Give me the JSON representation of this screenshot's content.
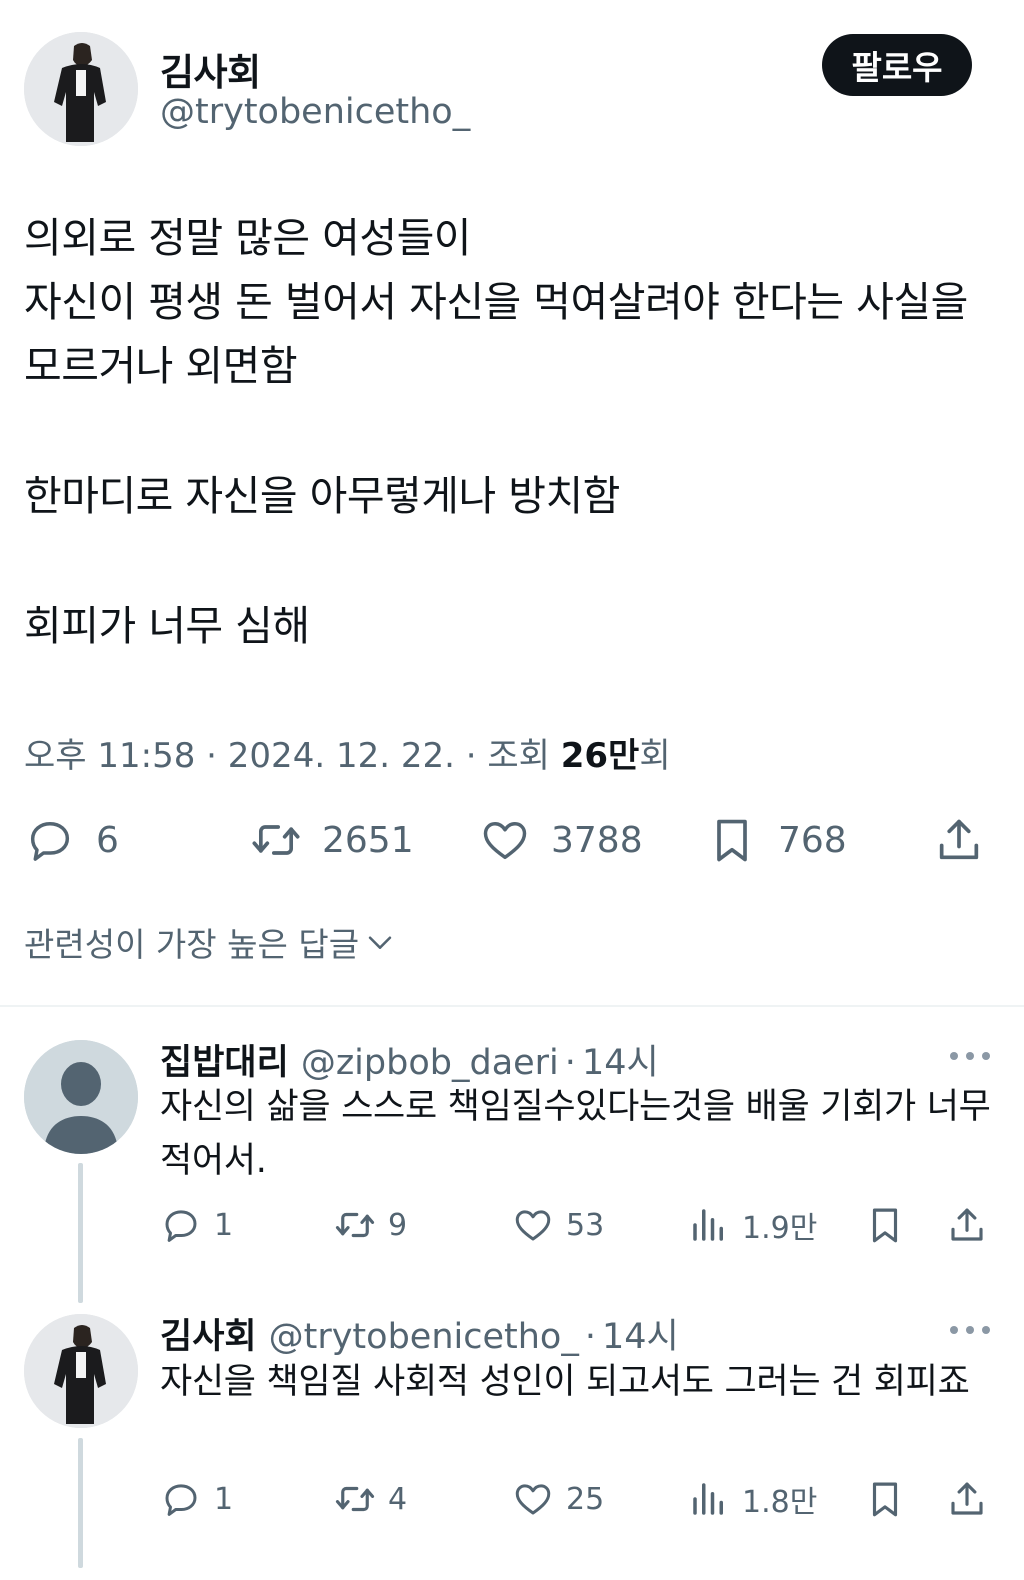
{
  "tweet": {
    "author_name": "김사회",
    "author_handle": "@trytobenicetho_",
    "follow_label": "팔로우",
    "lines": [
      "의외로 정말 많은 여성들이",
      "자신이 평생 돈 벌어서 자신을 먹여살려야 한다는 사실을",
      "모르거나 외면함",
      "",
      "한마디로 자신을 아무렇게나 방치함",
      "",
      "회피가 너무 심해"
    ],
    "time": "오후 11:58",
    "date": "2024. 12. 22.",
    "views_label": "조회",
    "views_count": "26만",
    "views_suffix": "회",
    "separator": "·",
    "stats": {
      "replies": "6",
      "retweets": "2651",
      "likes": "3788",
      "bookmarks": "768"
    }
  },
  "sort_label": "관련성이 가장 높은 답글",
  "replies": [
    {
      "name": "집밥대리",
      "handle": "@zipbob_daeri",
      "separator": "·",
      "time": "14시",
      "text": "자신의 삶을 스스로 책임질수있다는것을 배울 기회가 너무 적어서.",
      "avatar": "default-avatar",
      "stats": {
        "replies": "1",
        "retweets": "9",
        "likes": "53",
        "views": "1.9만"
      }
    },
    {
      "name": "김사회",
      "handle": "@trytobenicetho_",
      "separator": "·",
      "time": "14시",
      "text": "자신을 책임질 사회적 성인이 되고서도 그러는 건 회피죠",
      "avatar": "photo-avatar",
      "stats": {
        "replies": "1",
        "retweets": "4",
        "likes": "25",
        "views": "1.8만"
      }
    }
  ],
  "colors": {
    "text": "#0f1419",
    "secondary": "#536471",
    "follow_bg": "#0f1419",
    "divider": "#eff3f4",
    "thread_line": "#cfd9de"
  },
  "icons": [
    "reply-icon",
    "retweet-icon",
    "like-icon",
    "bookmark-icon",
    "share-icon",
    "views-icon",
    "more-icon",
    "chevron-down-icon"
  ]
}
